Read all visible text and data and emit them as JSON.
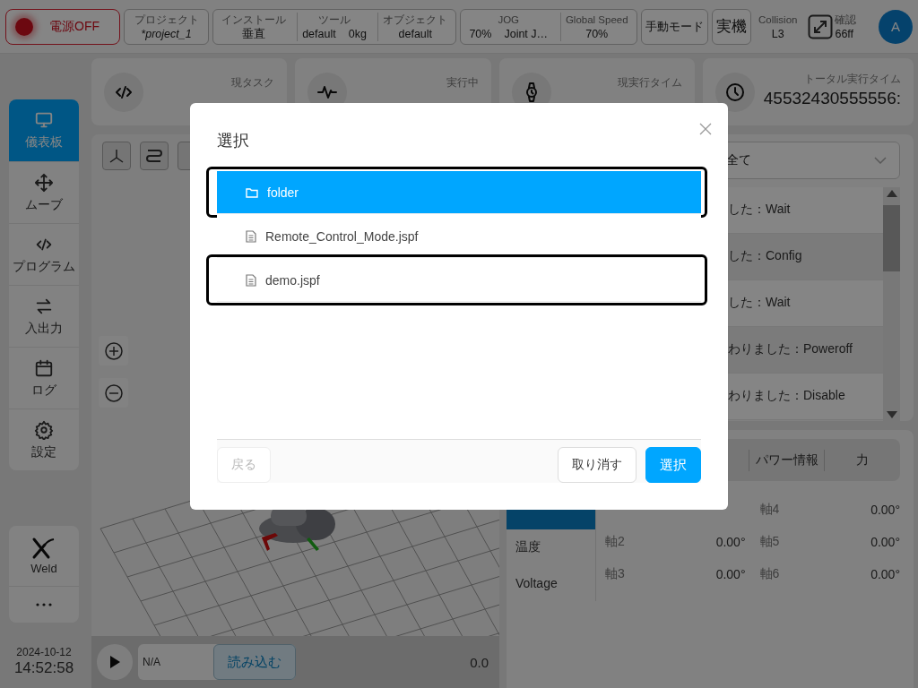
{
  "top_bar": {
    "power": {
      "label": "電源OFF",
      "on": false
    },
    "project": {
      "label": "プロジェクト",
      "value": "*project_1"
    },
    "install_group": [
      {
        "label": "インストール",
        "values": [
          "垂直"
        ]
      },
      {
        "label": "ツール",
        "values": [
          "default",
          "0kg"
        ]
      },
      {
        "label": "オブジェクト",
        "values": [
          "default"
        ]
      }
    ],
    "speed_group": [
      {
        "label": "JOG",
        "values": [
          "70%",
          "Joint J…"
        ]
      },
      {
        "label": "Global Speed",
        "values": [
          "70%"
        ]
      }
    ],
    "mode_buttons": [
      "手動モード",
      "実機"
    ],
    "collision": {
      "label": "Collision",
      "value": "L3"
    },
    "confirm": {
      "label": "確認",
      "value": "66ff"
    },
    "avatar": "A"
  },
  "sidebar": {
    "nav": [
      {
        "label": "儀表板",
        "selected": true
      },
      {
        "label": "ムーブ",
        "selected": false
      },
      {
        "label": "プログラム",
        "selected": false
      },
      {
        "label": "入出力",
        "selected": false
      },
      {
        "label": "ログ",
        "selected": false
      },
      {
        "label": "設定",
        "selected": false
      }
    ],
    "tools": [
      {
        "label": "Weld"
      }
    ],
    "date": "2024-10-12",
    "time": "14:52:58"
  },
  "stat_cards": [
    {
      "label": "現タスク"
    },
    {
      "label": "実行中"
    },
    {
      "label": "現実行タイム"
    },
    {
      "label": "トータル実行タイム",
      "value": "45532430555556:"
    }
  ],
  "viewer": {
    "playbar": {
      "program": "N/A",
      "load_button": "読み込む",
      "reading": "0.0"
    }
  },
  "log": {
    "filter": "全て",
    "entries": [
      "した：Wait",
      "した：Config",
      "した：Wait",
      "わりました：Poweroff",
      "わりました：Disable"
    ]
  },
  "info": {
    "tabs": [
      {
        "label": "パワー情報",
        "selected": false
      },
      {
        "label": "力",
        "selected": false
      }
    ],
    "side_tabs": [
      {
        "label": "温度",
        "selected": false
      },
      {
        "label": "Voltage",
        "selected": false
      }
    ],
    "joints": [
      {
        "label": "軸2",
        "value": "0.00°"
      },
      {
        "label": "軸3",
        "value": "0.00°"
      },
      {
        "label": "軸4",
        "value": "0.00°"
      },
      {
        "label": "軸5",
        "value": "0.00°"
      },
      {
        "label": "軸6",
        "value": "0.00°"
      }
    ]
  },
  "dialog": {
    "title": "選択",
    "items": [
      {
        "kind": "folder",
        "name": "folder",
        "selected": true,
        "outlined": true
      },
      {
        "kind": "file",
        "name": "Remote_Control_Mode.jspf",
        "selected": false,
        "outlined": false
      },
      {
        "kind": "file",
        "name": "demo.jspf",
        "selected": false,
        "outlined": true
      }
    ],
    "back_button": {
      "label": "戻る",
      "disabled": true
    },
    "cancel_button": "取り消す",
    "select_button": "選択"
  }
}
